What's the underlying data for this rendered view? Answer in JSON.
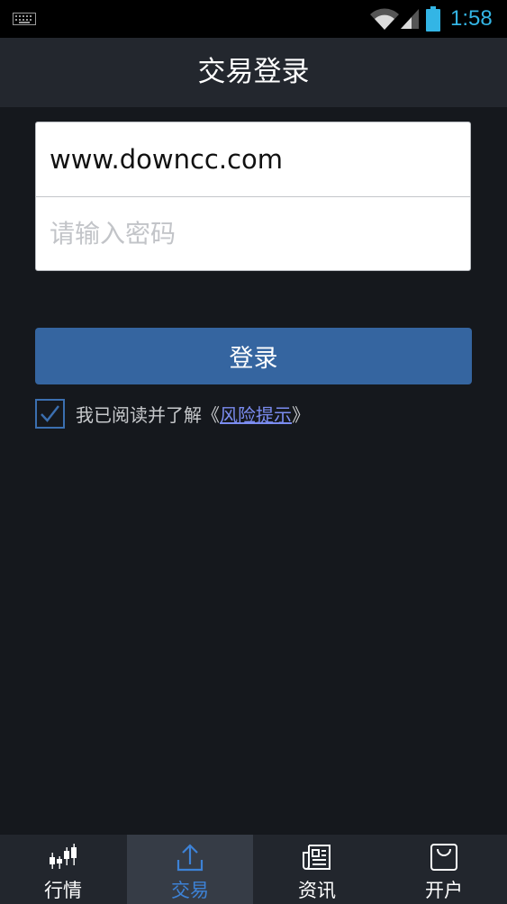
{
  "status_bar": {
    "time": "1:58",
    "icons": [
      "keyboard-icon",
      "wifi-icon",
      "signal-icon",
      "battery-icon"
    ]
  },
  "header": {
    "title": "交易登录"
  },
  "login_form": {
    "account_value": "www.downcc.com",
    "password_placeholder": "请输入密码",
    "login_label": "登录"
  },
  "agreement": {
    "checked": true,
    "text_before": "我已阅读并了解《",
    "link_text": "风险提示",
    "text_after": "》"
  },
  "bottom_nav": {
    "tabs": [
      {
        "label": "行情",
        "icon": "candlestick-icon",
        "active": false
      },
      {
        "label": "交易",
        "icon": "upload-icon",
        "active": true
      },
      {
        "label": "资讯",
        "icon": "news-icon",
        "active": false
      },
      {
        "label": "开户",
        "icon": "shopping-bag-icon",
        "active": false
      }
    ]
  },
  "colors": {
    "background": "#15181d",
    "title_bar": "#23272e",
    "primary_button": "#3565a0",
    "active_tab_label": "#3d82d6",
    "link": "#7b8cf0",
    "clock": "#33b5e5"
  }
}
